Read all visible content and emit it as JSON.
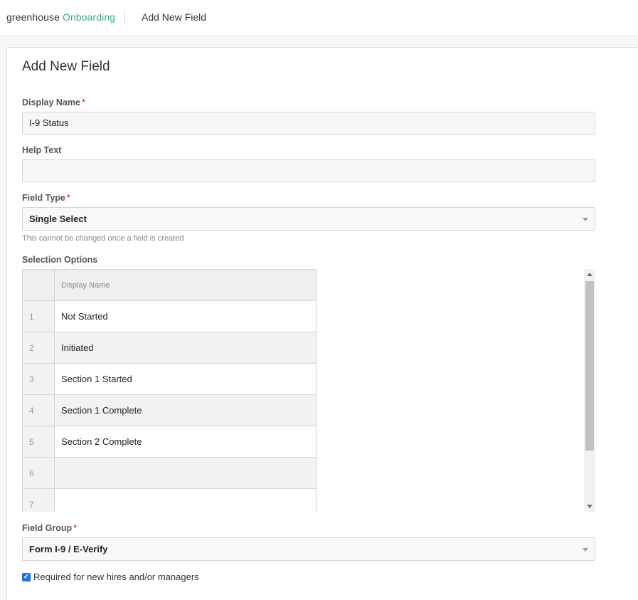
{
  "header": {
    "logo_part1": "greenhouse",
    "logo_part2": "Onboarding",
    "breadcrumb": "Add New Field"
  },
  "form": {
    "title": "Add New Field",
    "required_marker": "*",
    "display_name": {
      "label": "Display Name",
      "value": "I-9 Status"
    },
    "help_text": {
      "label": "Help Text",
      "value": ""
    },
    "field_type": {
      "label": "Field Type",
      "value": "Single Select",
      "hint": "This cannot be changed once a field is created"
    },
    "selection_options": {
      "label": "Selection Options",
      "column_header": "Display Name",
      "rows": [
        {
          "num": "1",
          "value": "Not Started"
        },
        {
          "num": "2",
          "value": "Initiated"
        },
        {
          "num": "3",
          "value": "Section 1 Started"
        },
        {
          "num": "4",
          "value": "Section 1 Complete"
        },
        {
          "num": "5",
          "value": "Section 2 Complete"
        },
        {
          "num": "6",
          "value": ""
        },
        {
          "num": "7",
          "value": ""
        }
      ]
    },
    "field_group": {
      "label": "Field Group",
      "value": "Form I-9 / E-Verify"
    },
    "required_checkbox": {
      "label": "Required for new hires and/or managers",
      "checked": true
    }
  },
  "colors": {
    "brand_green": "#3ba97a",
    "required_red": "#d0021b",
    "checkbox_blue": "#1a73e8"
  }
}
